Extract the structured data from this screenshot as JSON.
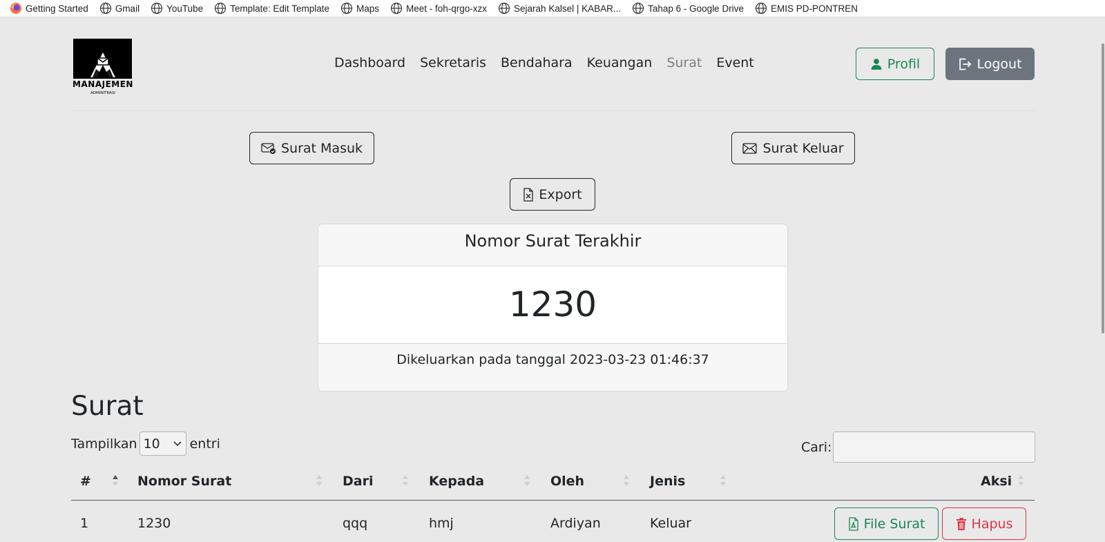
{
  "bookmarks": [
    {
      "label": "Getting Started",
      "icon": "firefox-icon"
    },
    {
      "label": "Gmail",
      "icon": "globe-icon"
    },
    {
      "label": "YouTube",
      "icon": "globe-icon"
    },
    {
      "label": "Template: Edit Template",
      "icon": "globe-icon"
    },
    {
      "label": "Maps",
      "icon": "globe-icon"
    },
    {
      "label": "Meet - foh-qrgo-xzx",
      "icon": "globe-icon"
    },
    {
      "label": "Sejarah Kalsel | KABAR...",
      "icon": "globe-icon"
    },
    {
      "label": "Tahap 6 - Google Drive",
      "icon": "globe-icon"
    },
    {
      "label": "EMIS PD-PONTREN",
      "icon": "globe-icon"
    }
  ],
  "logo": {
    "title": "MANAJEMEN",
    "subtitle": "ADMINITRASI"
  },
  "nav": {
    "items": [
      "Dashboard",
      "Sekretaris",
      "Bendahara",
      "Keuangan",
      "Surat",
      "Event"
    ],
    "active": "Surat"
  },
  "header": {
    "profil_label": "Profil",
    "logout_label": "Logout"
  },
  "actions": {
    "masuk_label": "Surat Masuk",
    "keluar_label": "Surat Keluar",
    "export_label": "Export"
  },
  "card": {
    "title": "Nomor Surat Terakhir",
    "number": "1230",
    "footer": "Dikeluarkan pada tanggal 2023-03-23 01:46:37"
  },
  "section": {
    "title": "Surat"
  },
  "entries": {
    "prefix": "Tampilkan",
    "value": "10",
    "suffix": "entri"
  },
  "search": {
    "label": "Cari:",
    "placeholder": ""
  },
  "table": {
    "headers": [
      "#",
      "Nomor Surat",
      "Dari",
      "Kepada",
      "Oleh",
      "Jenis",
      "Aksi"
    ],
    "rows": [
      {
        "no": "1",
        "nomor": "1230",
        "dari": "qqq",
        "kepada": "hmj",
        "oleh": "Ardiyan",
        "jenis": "Keluar",
        "file_label": "File Surat",
        "hapus_label": "Hapus"
      }
    ]
  },
  "colors": {
    "success": "#198754",
    "danger": "#dc3545",
    "secondary": "#6c757d",
    "background": "#e9e9e9"
  }
}
